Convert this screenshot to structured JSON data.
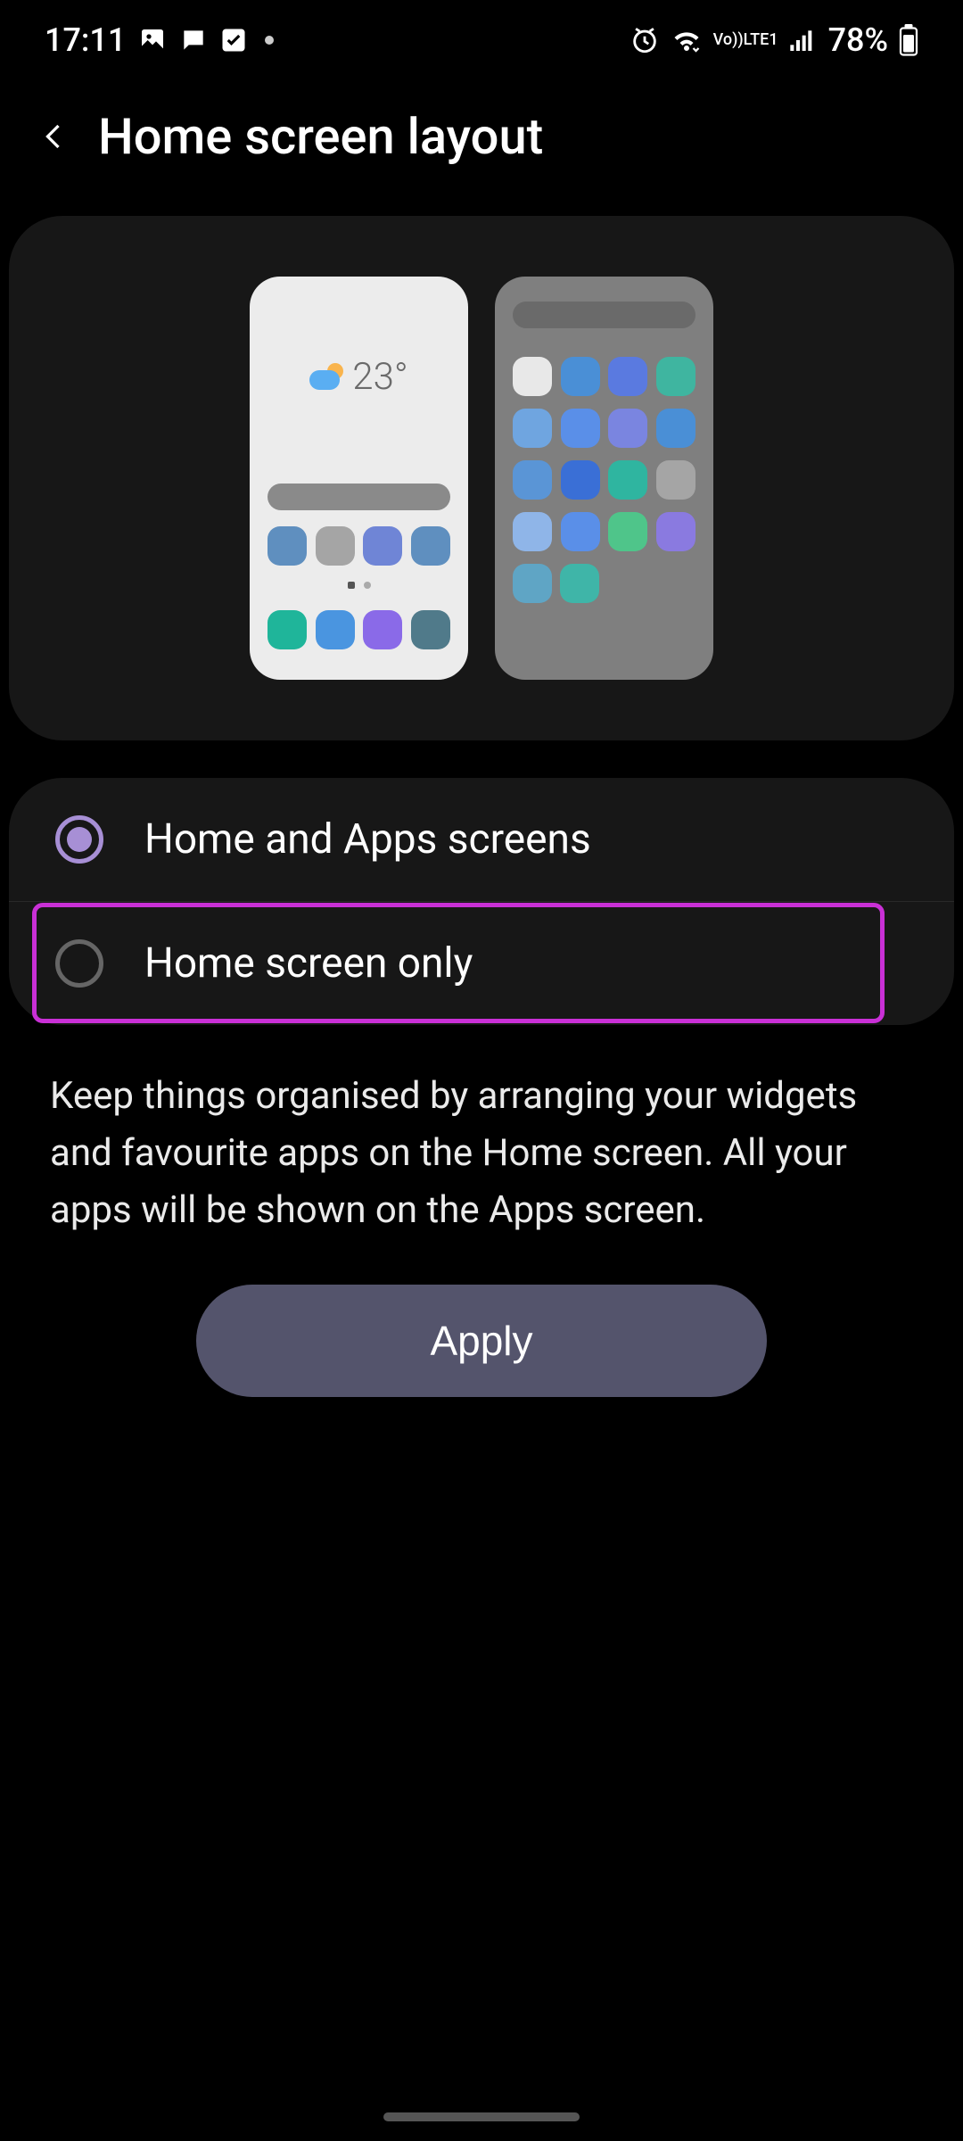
{
  "status": {
    "time": "17:11",
    "battery": "78%",
    "network_label": "LTE1",
    "volte_label": "Vo))"
  },
  "header": {
    "title": "Home screen layout"
  },
  "preview": {
    "weather_temp": "23°"
  },
  "options": [
    {
      "label": "Home and Apps screens",
      "selected": true
    },
    {
      "label": "Home screen only",
      "selected": false
    }
  ],
  "description": "Keep things organised by arranging your widgets and favourite apps on the Home screen. All your apps will be shown on the Apps screen.",
  "apply_label": "Apply"
}
